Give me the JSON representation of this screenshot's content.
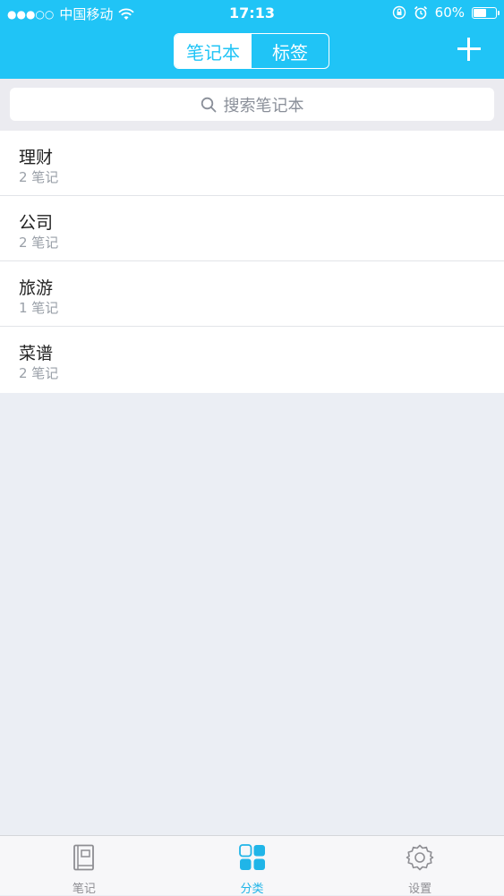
{
  "status_bar": {
    "signal": "●●●○○",
    "carrier": "中国移动",
    "time": "17:13",
    "battery_percent": "60%",
    "battery_level": 0.6
  },
  "nav": {
    "segments": [
      {
        "label": "笔记本",
        "active": true
      },
      {
        "label": "标签",
        "active": false
      }
    ],
    "add_icon": "plus-icon"
  },
  "search": {
    "placeholder": "搜索笔记本",
    "icon": "search-icon"
  },
  "notebooks": [
    {
      "name": "理财",
      "count": "2 笔记"
    },
    {
      "name": "公司",
      "count": "2 笔记"
    },
    {
      "name": "旅游",
      "count": "1 笔记"
    },
    {
      "name": "菜谱",
      "count": "2 笔记"
    }
  ],
  "tab_bar": {
    "tabs": [
      {
        "label": "笔记",
        "icon": "notebook-icon",
        "active": false
      },
      {
        "label": "分类",
        "icon": "grid-icon",
        "active": true
      },
      {
        "label": "设置",
        "icon": "gear-icon",
        "active": false
      }
    ]
  },
  "colors": {
    "accent": "#20c4f6",
    "active_tab": "#20b5e8",
    "background": "#ebeef4"
  }
}
